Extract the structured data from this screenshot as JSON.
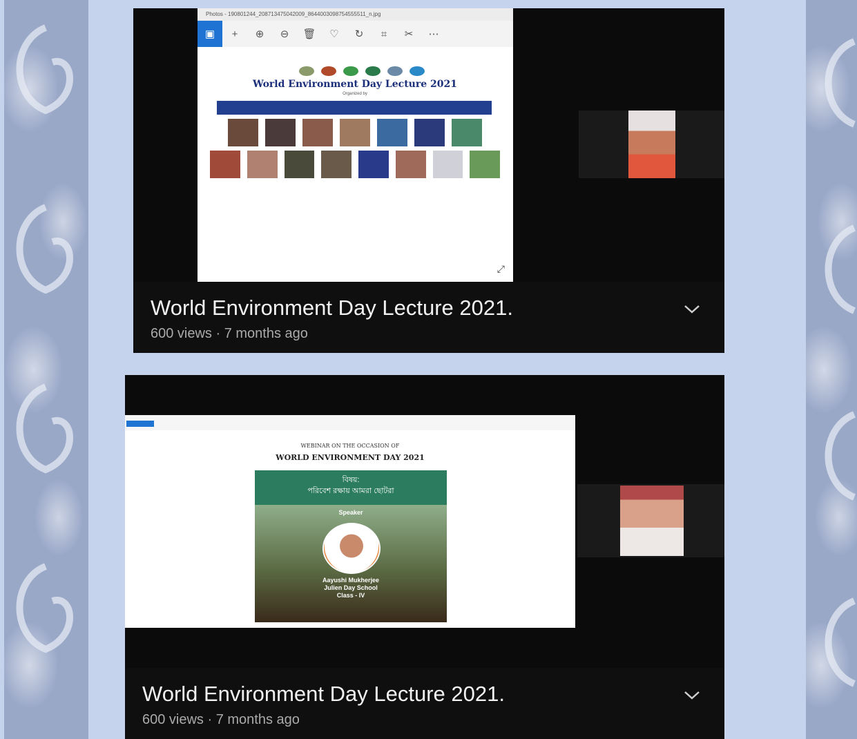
{
  "videos": [
    {
      "title": "World Environment Day Lecture 2021.",
      "meta": "600 views · 7 months ago",
      "viewer_title": "Photos - 190801244_208713475042009_8644003098754555511_n.jpg",
      "poster": {
        "title": "World Environment Day Lecture 2021",
        "subtitle": "Organized by"
      }
    },
    {
      "title": "World Environment Day Lecture 2021.",
      "meta": "600 views · 7 months ago",
      "slide": {
        "heading_small": "WEBINAR ON THE OCCASION OF",
        "heading_large": "WORLD ENVIRONMENT DAY 2021",
        "topic_line1": "বিষয়:",
        "topic_line2": "পরিবেশ রক্ষায় আমরা ছোটরা",
        "speaker_label": "Speaker",
        "speaker_name": "Aayushi Mukherjee",
        "speaker_school": "Julien Day School",
        "speaker_class": "Class - IV"
      }
    }
  ],
  "icons": {
    "expand": "expand-icon",
    "chevron": "chevron-down-icon"
  }
}
